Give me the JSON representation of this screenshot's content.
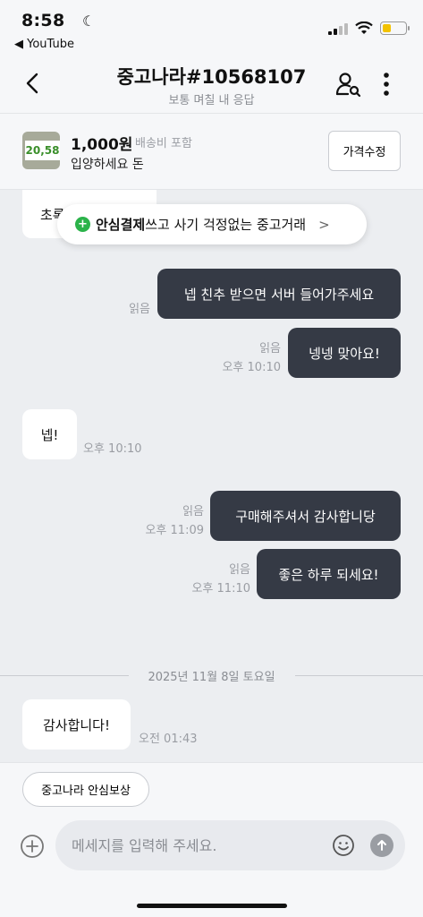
{
  "status_bar": {
    "time": "8:58",
    "back_app": "◀ YouTube"
  },
  "header": {
    "title": "중고나라#10568107",
    "subtitle": "보통 며칠 내 응답"
  },
  "product": {
    "thumb_text": "20,58",
    "price": "1,000원",
    "shipping": "배송비 포함",
    "name": "입양하세요 돈",
    "edit_label": "가격수정"
  },
  "banner": {
    "bold": "안심결제",
    "rest": "쓰고 사기 걱정없는 중고거래"
  },
  "messages": [
    {
      "text": "초록",
      "side": "theirs"
    },
    {
      "text": "넵 친추 받으면 서버 들어가주세요",
      "side": "mine",
      "read": "읽음",
      "time": ""
    },
    {
      "text": "넹넹 맞아요!",
      "side": "mine",
      "read": "읽음",
      "time": "오후 10:10"
    },
    {
      "text": "넵!",
      "side": "theirs",
      "time": "오후 10:10"
    },
    {
      "text": "구매해주셔서 감사합니당",
      "side": "mine",
      "read": "읽음",
      "time": "오후 11:09"
    },
    {
      "text": "좋은 하루 되세요!",
      "side": "mine",
      "read": "읽음",
      "time": "오후 11:10"
    },
    {
      "text": "감사합니다!",
      "side": "theirs",
      "time": "오전 01:43"
    }
  ],
  "date_divider": "2025년 11월 8일 토요일",
  "bottom": {
    "safe_label": "중고나라 안심보상",
    "input_placeholder": "메세지를 입력해 주세요."
  },
  "colors": {
    "my_bubble": "#353a45",
    "their_bubble": "#ffffff",
    "chat_bg": "#eceef1",
    "accent_green": "#2bb34a",
    "battery": "#f2c200"
  }
}
